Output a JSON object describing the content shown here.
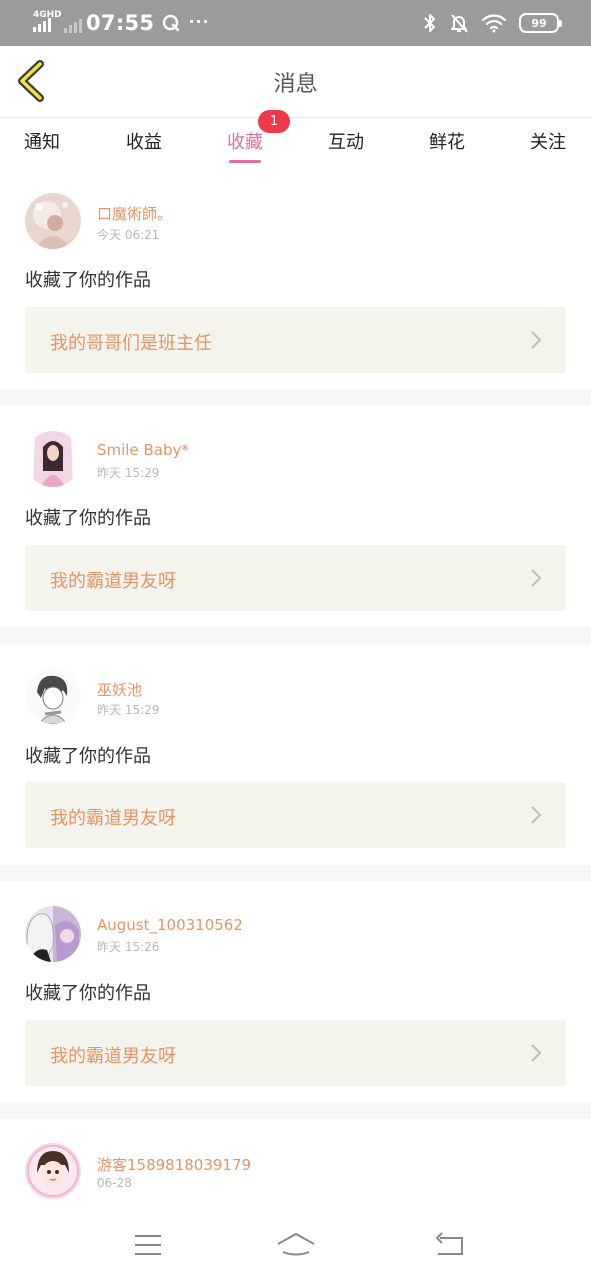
{
  "status_bar": {
    "network": "4GHD",
    "time": "07:55",
    "battery": "99"
  },
  "header": {
    "title": "消息"
  },
  "tabs": [
    {
      "label": "通知",
      "active": false
    },
    {
      "label": "收益",
      "active": false
    },
    {
      "label": "收藏",
      "active": true,
      "badge": "1"
    },
    {
      "label": "互动",
      "active": false
    },
    {
      "label": "鲜花",
      "active": false
    },
    {
      "label": "关注",
      "active": false
    }
  ],
  "messages": [
    {
      "user": "口魔術師。",
      "time": "今天 06:21",
      "action": "收藏了你的作品",
      "work": "我的哥哥们是班主任"
    },
    {
      "user": "Smile Baby*",
      "time": "昨天 15:29",
      "action": "收藏了你的作品",
      "work": "我的霸道男友呀"
    },
    {
      "user": "巫妖池",
      "time": "昨天 15:29",
      "action": "收藏了你的作品",
      "work": "我的霸道男友呀"
    },
    {
      "user": "August_100310562",
      "time": "昨天 15:26",
      "action": "收藏了你的作品",
      "work": "我的霸道男友呀"
    },
    {
      "user": "游客1589818039179",
      "time": "06-28"
    }
  ],
  "colors": {
    "accent": "#e06fa0",
    "username": "#e49466",
    "badge": "#f0394a",
    "work_bg": "#f4f3ec"
  }
}
